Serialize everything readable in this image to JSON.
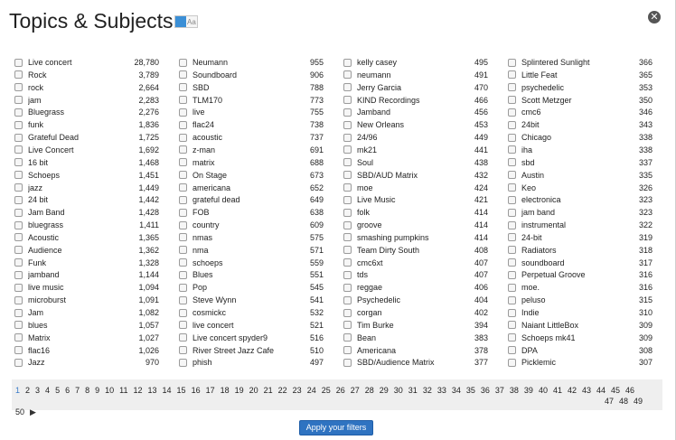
{
  "modal": {
    "title": "Topics & Subjects",
    "toggle_text": "Aa",
    "close_icon": "close-icon"
  },
  "columns": [
    [
      {
        "label": "Live concert",
        "count": "28,780"
      },
      {
        "label": "Rock",
        "count": "3,789"
      },
      {
        "label": "rock",
        "count": "2,664"
      },
      {
        "label": "jam",
        "count": "2,283"
      },
      {
        "label": "Bluegrass",
        "count": "2,276"
      },
      {
        "label": "funk",
        "count": "1,836"
      },
      {
        "label": "Grateful Dead",
        "count": "1,725"
      },
      {
        "label": "Live Concert",
        "count": "1,692"
      },
      {
        "label": "16 bit",
        "count": "1,468"
      },
      {
        "label": "Schoeps",
        "count": "1,451"
      },
      {
        "label": "jazz",
        "count": "1,449"
      },
      {
        "label": "24 bit",
        "count": "1,442"
      },
      {
        "label": "Jam Band",
        "count": "1,428"
      },
      {
        "label": "bluegrass",
        "count": "1,411"
      },
      {
        "label": "Acoustic",
        "count": "1,365"
      },
      {
        "label": "Audience",
        "count": "1,362"
      },
      {
        "label": "Funk",
        "count": "1,328"
      },
      {
        "label": "jamband",
        "count": "1,144"
      },
      {
        "label": "live music",
        "count": "1,094"
      },
      {
        "label": "microburst",
        "count": "1,091"
      },
      {
        "label": "Jam",
        "count": "1,082"
      },
      {
        "label": "blues",
        "count": "1,057"
      },
      {
        "label": "Matrix",
        "count": "1,027"
      },
      {
        "label": "flac16",
        "count": "1,026"
      },
      {
        "label": "Jazz",
        "count": "970"
      }
    ],
    [
      {
        "label": "Neumann",
        "count": "955"
      },
      {
        "label": "Soundboard",
        "count": "906"
      },
      {
        "label": "SBD",
        "count": "788"
      },
      {
        "label": "TLM170",
        "count": "773"
      },
      {
        "label": "live",
        "count": "755"
      },
      {
        "label": "flac24",
        "count": "738"
      },
      {
        "label": "acoustic",
        "count": "737"
      },
      {
        "label": "z-man",
        "count": "691"
      },
      {
        "label": "matrix",
        "count": "688"
      },
      {
        "label": "On Stage",
        "count": "673"
      },
      {
        "label": "americana",
        "count": "652"
      },
      {
        "label": "grateful dead",
        "count": "649"
      },
      {
        "label": "FOB",
        "count": "638"
      },
      {
        "label": "country",
        "count": "609"
      },
      {
        "label": "nmas",
        "count": "575"
      },
      {
        "label": "nma",
        "count": "571"
      },
      {
        "label": "schoeps",
        "count": "559"
      },
      {
        "label": "Blues",
        "count": "551"
      },
      {
        "label": "Pop",
        "count": "545"
      },
      {
        "label": "Steve Wynn",
        "count": "541"
      },
      {
        "label": "cosmickc",
        "count": "532"
      },
      {
        "label": "live concert",
        "count": "521"
      },
      {
        "label": "Live concert spyder9",
        "count": "516"
      },
      {
        "label": "River Street Jazz Cafe",
        "count": "510"
      },
      {
        "label": "phish",
        "count": "497"
      }
    ],
    [
      {
        "label": "kelly casey",
        "count": "495"
      },
      {
        "label": "neumann",
        "count": "491"
      },
      {
        "label": "Jerry Garcia",
        "count": "470"
      },
      {
        "label": "KIND Recordings",
        "count": "466"
      },
      {
        "label": "Jamband",
        "count": "456"
      },
      {
        "label": "New Orleans",
        "count": "453"
      },
      {
        "label": "24/96",
        "count": "449"
      },
      {
        "label": "mk21",
        "count": "441"
      },
      {
        "label": "Soul",
        "count": "438"
      },
      {
        "label": "SBD/AUD Matrix",
        "count": "432"
      },
      {
        "label": "moe",
        "count": "424"
      },
      {
        "label": "Live Music",
        "count": "421"
      },
      {
        "label": "folk",
        "count": "414"
      },
      {
        "label": "groove",
        "count": "414"
      },
      {
        "label": "smashing pumpkins",
        "count": "414"
      },
      {
        "label": "Team Dirty South",
        "count": "408"
      },
      {
        "label": "cmc6xt",
        "count": "407"
      },
      {
        "label": "tds",
        "count": "407"
      },
      {
        "label": "reggae",
        "count": "406"
      },
      {
        "label": "Psychedelic",
        "count": "404"
      },
      {
        "label": "corgan",
        "count": "402"
      },
      {
        "label": "Tim Burke",
        "count": "394"
      },
      {
        "label": "Bean",
        "count": "383"
      },
      {
        "label": "Americana",
        "count": "378"
      },
      {
        "label": "SBD/Audience Matrix",
        "count": "377"
      }
    ],
    [
      {
        "label": "Splintered Sunlight",
        "count": "366"
      },
      {
        "label": "Little Feat",
        "count": "365"
      },
      {
        "label": "psychedelic",
        "count": "353"
      },
      {
        "label": "Scott Metzger",
        "count": "350"
      },
      {
        "label": "cmc6",
        "count": "346"
      },
      {
        "label": "24bit",
        "count": "343"
      },
      {
        "label": "Chicago",
        "count": "338"
      },
      {
        "label": "iha",
        "count": "338"
      },
      {
        "label": "sbd",
        "count": "337"
      },
      {
        "label": "Austin",
        "count": "335"
      },
      {
        "label": "Keo",
        "count": "326"
      },
      {
        "label": "electronica",
        "count": "323"
      },
      {
        "label": "jam band",
        "count": "323"
      },
      {
        "label": "instrumental",
        "count": "322"
      },
      {
        "label": "24-bit",
        "count": "319"
      },
      {
        "label": "Radiators",
        "count": "318"
      },
      {
        "label": "soundboard",
        "count": "317"
      },
      {
        "label": "Perpetual Groove",
        "count": "316"
      },
      {
        "label": "moe.",
        "count": "316"
      },
      {
        "label": "peluso",
        "count": "315"
      },
      {
        "label": "Indie",
        "count": "310"
      },
      {
        "label": "Naiant LittleBox",
        "count": "309"
      },
      {
        "label": "Schoeps mk41",
        "count": "309"
      },
      {
        "label": "DPA",
        "count": "308"
      },
      {
        "label": "Picklemic",
        "count": "307"
      }
    ]
  ],
  "pagination": {
    "current": "1",
    "pages": [
      "1",
      "2",
      "3",
      "4",
      "5",
      "6",
      "7",
      "8",
      "9",
      "10",
      "11",
      "12",
      "13",
      "14",
      "15",
      "16",
      "17",
      "18",
      "19",
      "20",
      "21",
      "22",
      "23",
      "24",
      "25",
      "26",
      "27",
      "28",
      "29",
      "30",
      "31",
      "32",
      "33",
      "34",
      "35",
      "36",
      "37",
      "38",
      "39",
      "40",
      "41",
      "42",
      "43",
      "44",
      "45",
      "46",
      "47",
      "48",
      "49",
      "50"
    ],
    "next_icon": "next-arrow-icon"
  },
  "apply_button": {
    "label": "Apply your filters"
  }
}
